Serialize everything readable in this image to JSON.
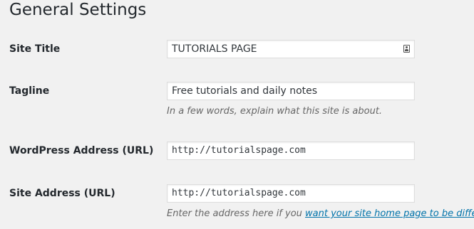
{
  "page": {
    "title": "General Settings"
  },
  "fields": {
    "site_title": {
      "label": "Site Title",
      "value": "TUTORIALS PAGE"
    },
    "tagline": {
      "label": "Tagline",
      "value": "Free tutorials and daily notes",
      "description": "In a few words, explain what this site is about."
    },
    "wordpress_address": {
      "label": "WordPress Address (URL)",
      "value": "http://tutorialspage.com"
    },
    "site_address": {
      "label": "Site Address (URL)",
      "value": "http://tutorialspage.com",
      "description_prefix": "Enter the address here if you ",
      "description_link": "want your site home page to be different"
    }
  },
  "icons": {
    "site_title_field_icon": "contact-card-icon"
  },
  "colors": {
    "background": "#f1f1f1",
    "link": "#0073aa",
    "description_text": "#666666",
    "label_text": "#23282d"
  }
}
